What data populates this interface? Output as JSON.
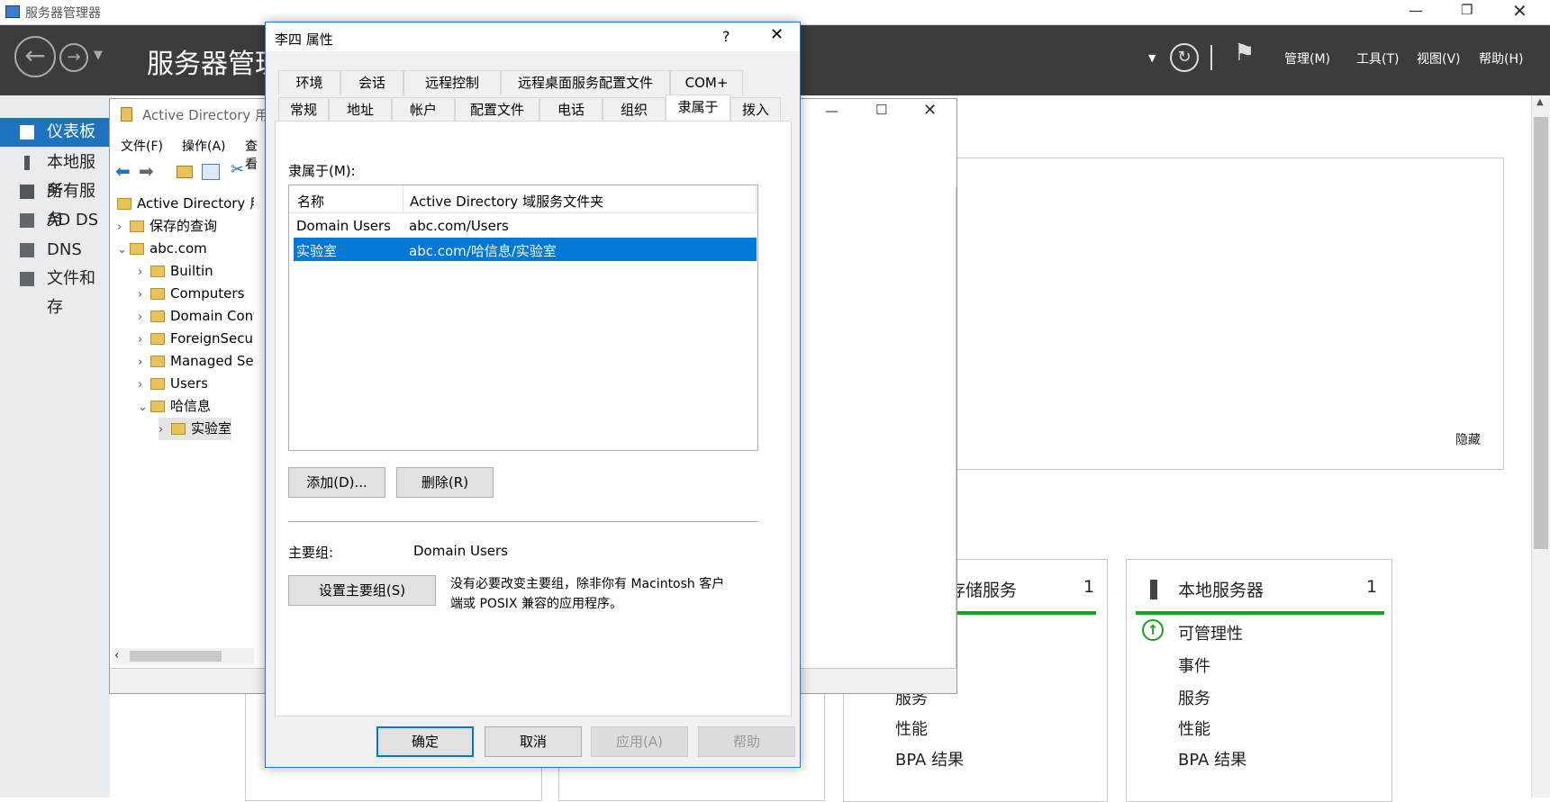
{
  "server_manager": {
    "window_title": "服务器管理器",
    "ribbon_title": "服务器管理",
    "menu": [
      "管理(M)",
      "工具(T)",
      "视图(V)",
      "帮助(H)"
    ],
    "nav": [
      {
        "label": "仪表板",
        "icon": "dashboard-icon"
      },
      {
        "label": "本地服务",
        "icon": "server-icon"
      },
      {
        "label": "所有服务",
        "icon": "servers-icon"
      },
      {
        "label": "AD DS",
        "icon": "ad-ds-icon"
      },
      {
        "label": "DNS",
        "icon": "dns-icon"
      },
      {
        "label": "文件和存",
        "icon": "file-storage-icon"
      }
    ],
    "hide_label": "隐藏",
    "tile_storage": {
      "title": "存储服务",
      "count": "1",
      "items": [
        "服务",
        "性能",
        "BPA 结果"
      ]
    },
    "tile_local": {
      "title": "本地服务器",
      "count": "1",
      "items": [
        "可管理性",
        "事件",
        "服务",
        "性能",
        "BPA 结果"
      ]
    },
    "colors": {
      "ribbon": "#3c3c3c",
      "accent": "#1e73be",
      "green": "#17a317"
    }
  },
  "ad": {
    "window_title": "Active Directory 用",
    "menu": [
      "文件(F)",
      "操作(A)",
      "查看"
    ],
    "tree_root": "Active Directory 用户",
    "tree": [
      {
        "label": "保存的查询",
        "indent": 0,
        "chev": "›"
      },
      {
        "label": "abc.com",
        "indent": 0,
        "chev": "⌄"
      },
      {
        "label": "Builtin",
        "indent": 1,
        "chev": "›"
      },
      {
        "label": "Computers",
        "indent": 1,
        "chev": "›"
      },
      {
        "label": "Domain Cont",
        "indent": 1,
        "chev": "›"
      },
      {
        "label": "ForeignSecur",
        "indent": 1,
        "chev": "›"
      },
      {
        "label": "Managed Se",
        "indent": 1,
        "chev": "›"
      },
      {
        "label": "Users",
        "indent": 1,
        "chev": "›"
      },
      {
        "label": "哈信息",
        "indent": 1,
        "chev": "⌄"
      },
      {
        "label": "实验室",
        "indent": 2,
        "chev": "›"
      }
    ]
  },
  "dialog": {
    "title": "李四 属性",
    "help_glyph": "?",
    "tabs_row1": [
      "环境",
      "会话",
      "远程控制",
      "远程桌面服务配置文件",
      "COM+"
    ],
    "tabs_row2": [
      "常规",
      "地址",
      "帐户",
      "配置文件",
      "电话",
      "组织",
      "隶属于",
      "拨入"
    ],
    "member_of_label": "隶属于(M):",
    "columns": [
      "名称",
      "Active Directory 域服务文件夹"
    ],
    "rows": [
      {
        "name": "Domain Users",
        "folder": "abc.com/Users"
      },
      {
        "name": "实验室",
        "folder": "abc.com/哈信息/实验室"
      }
    ],
    "add_button": "添加(D)...",
    "remove_button": "删除(R)",
    "primary_group_label": "主要组:",
    "primary_group_value": "Domain Users",
    "set_primary_button": "设置主要组(S)",
    "primary_note_1": "没有必要改变主要组，除非你有 Macintosh 客户",
    "primary_note_2": "端或 POSIX 兼容的应用程序。",
    "ok": "确定",
    "cancel": "取消",
    "apply": "应用(A)",
    "help": "帮助"
  }
}
